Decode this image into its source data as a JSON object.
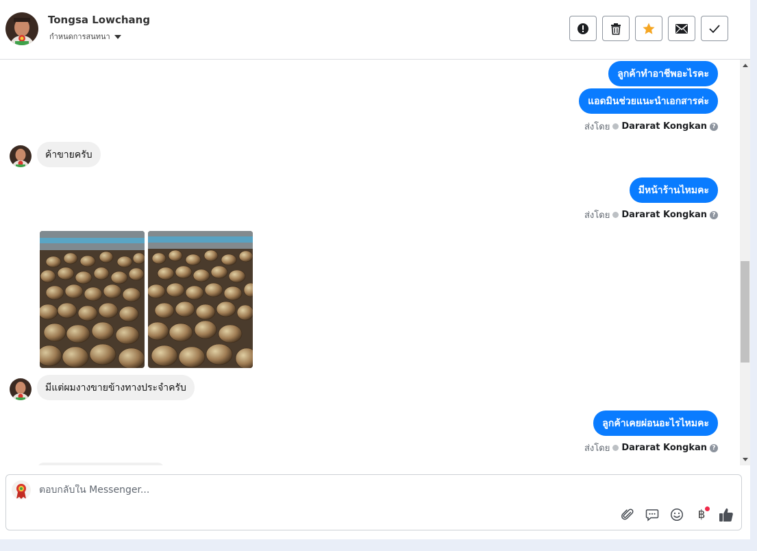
{
  "header": {
    "contact_name": "Tongsa Lowchang",
    "assign_label": "กำหนดการสนทนา",
    "actions": [
      {
        "name": "alert-icon",
        "color": "#1c1e21"
      },
      {
        "name": "trash-icon",
        "color": "#1c1e21"
      },
      {
        "name": "star-icon",
        "color": "#f5a623"
      },
      {
        "name": "envelope-icon",
        "color": "#1c1e21"
      },
      {
        "name": "checkmark-icon",
        "color": "#1c1e21"
      }
    ]
  },
  "messages": {
    "m1": "ลูกค้าทำอาชีพอะไรคะ",
    "m2": "แอดมินช่วยแนะนำเอกสารค่ะ",
    "m3": "ค้าขายครับ",
    "m4": "มีหน้าร้านไหมคะ",
    "m5": "มีแต่ผมงางขายข้างทางประจำครับ",
    "m6": "ลูกค้าเคยผ่อนอะไรไหมคะ"
  },
  "sent_by": {
    "prefix": "ส่งโดย",
    "agent": "Dararat Kongkan"
  },
  "composer": {
    "placeholder": "ตอบกลับใน Messenger...",
    "currency_symbol": "฿"
  },
  "colors": {
    "outgoing_bubble": "#0a7cff",
    "incoming_bubble": "#f0f0f0",
    "like_icon": "#4b4f56"
  }
}
